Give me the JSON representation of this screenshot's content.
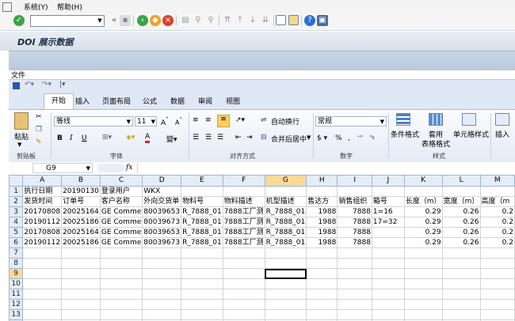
{
  "menu": {
    "system": "系统(Y)",
    "help": "帮助(H)"
  },
  "title": "DOI 展示数据",
  "file_label": "文件",
  "excel": {
    "tabs": [
      "开始",
      "插入",
      "页面布局",
      "公式",
      "数据",
      "审阅",
      "视图"
    ],
    "groups": {
      "clipboard": "剪贴板",
      "font": "字体",
      "align": "对齐方式",
      "number": "数字",
      "style": "样式"
    },
    "font_name": "等线",
    "font_size": "11",
    "paste": "粘贴",
    "wrap": "自动换行",
    "merge": "合并后居中",
    "number_format": "常规",
    "cond_format": "条件格式",
    "table_format_1": "套用",
    "table_format_2": "表格格式",
    "cell_style": "单元格样式",
    "insert": "插入",
    "name_box": "G9",
    "fx": "fx"
  },
  "sheet": {
    "columns": [
      "A",
      "B",
      "C",
      "D",
      "E",
      "F",
      "G",
      "H",
      "I",
      "J",
      "K",
      "L",
      "M"
    ],
    "selected_column": "G",
    "selected_row": 9,
    "rows": [
      {
        "n": "1",
        "c": [
          "执行日期",
          "20190130",
          "登录用户",
          "WKX",
          "",
          "",
          "",
          "",
          "",
          "",
          "",
          "",
          ""
        ]
      },
      {
        "n": "2",
        "c": [
          "发货时间",
          "订单号",
          "客户名称",
          "外向交货单",
          "物料号",
          "物料描述",
          "机型描述",
          "售达方",
          "销售组织",
          "箱号",
          "长度（m）",
          "宽度（m）",
          "高度（m"
        ]
      },
      {
        "n": "3",
        "c": [
          "20170808",
          "20025164",
          "GE Comme",
          "80039653",
          "R_7888_01",
          "7888工厂测",
          "R_7888_01",
          "1988",
          "7888",
          "1=16",
          "0.29",
          "0.26",
          "0.2"
        ]
      },
      {
        "n": "4",
        "c": [
          "20190112",
          "20025186",
          "GE Comme",
          "80039673",
          "R_7888_01",
          "7888工厂测",
          "R_7888_01",
          "1988",
          "7888",
          "17=32",
          "0.29",
          "0.26",
          "0.2"
        ]
      },
      {
        "n": "5",
        "c": [
          "20170808",
          "20025164",
          "GE Comme",
          "80039653",
          "R_7888_01",
          "7888工厂测",
          "R_7888_01",
          "1988",
          "7888",
          "",
          "0.29",
          "0.26",
          "0.2"
        ]
      },
      {
        "n": "6",
        "c": [
          "20190112",
          "20025186",
          "GE Comme",
          "80039673",
          "R_7888_01",
          "7888工厂测",
          "R_7888_01",
          "1988",
          "7888",
          "",
          "0.29",
          "0.26",
          "0.2"
        ]
      },
      {
        "n": "7",
        "c": [
          "",
          "",
          "",
          "",
          "",
          "",
          "",
          "",
          "",
          "",
          "",
          "",
          ""
        ]
      },
      {
        "n": "8",
        "c": [
          "",
          "",
          "",
          "",
          "",
          "",
          "",
          "",
          "",
          "",
          "",
          "",
          ""
        ]
      },
      {
        "n": "9",
        "c": [
          "",
          "",
          "",
          "",
          "",
          "",
          "",
          "",
          "",
          "",
          "",
          "",
          ""
        ]
      },
      {
        "n": "10",
        "c": [
          "",
          "",
          "",
          "",
          "",
          "",
          "",
          "",
          "",
          "",
          "",
          "",
          ""
        ]
      },
      {
        "n": "11",
        "c": [
          "",
          "",
          "",
          "",
          "",
          "",
          "",
          "",
          "",
          "",
          "",
          "",
          ""
        ]
      },
      {
        "n": "12",
        "c": [
          "",
          "",
          "",
          "",
          "",
          "",
          "",
          "",
          "",
          "",
          "",
          "",
          ""
        ]
      },
      {
        "n": "13",
        "c": [
          "",
          "",
          "",
          "",
          "",
          "",
          "",
          "",
          "",
          "",
          "",
          "",
          ""
        ]
      },
      {
        "n": "14",
        "c": [
          "",
          "",
          "",
          "",
          "",
          "",
          "",
          "",
          "",
          "",
          "",
          "",
          ""
        ]
      }
    ]
  }
}
